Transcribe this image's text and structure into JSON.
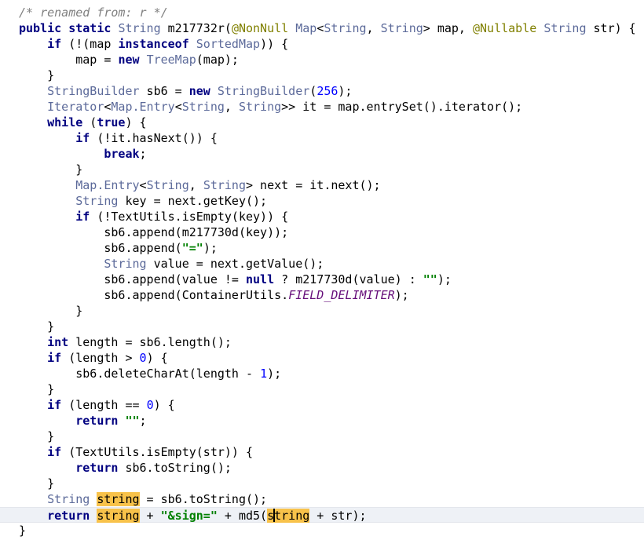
{
  "colors": {
    "keyword": "#000080",
    "type": "#5c6a9a",
    "annotation": "#808000",
    "number": "#0000ff",
    "string": "#008000",
    "comment": "#808080",
    "static_field": "#660e7a",
    "occurrence_highlight": "#f8c24a",
    "current_line": "#eef1f6"
  },
  "editor": {
    "current_line_index": 32,
    "lines": [
      {
        "indent": "",
        "tokens": [
          {
            "t": "/* renamed from: r */",
            "k": "cm"
          }
        ]
      },
      {
        "indent": "",
        "tokens": [
          {
            "t": "public",
            "k": "kw"
          },
          {
            "t": " "
          },
          {
            "t": "static",
            "k": "kw"
          },
          {
            "t": " "
          },
          {
            "t": "String",
            "k": "ty"
          },
          {
            "t": " m217732r("
          },
          {
            "t": "@NonNull",
            "k": "ann"
          },
          {
            "t": " "
          },
          {
            "t": "Map",
            "k": "ty"
          },
          {
            "t": "<"
          },
          {
            "t": "String",
            "k": "ty"
          },
          {
            "t": ", "
          },
          {
            "t": "String",
            "k": "ty"
          },
          {
            "t": "> map, "
          },
          {
            "t": "@Nullable",
            "k": "ann"
          },
          {
            "t": " "
          },
          {
            "t": "String",
            "k": "ty"
          },
          {
            "t": " str) {"
          }
        ]
      },
      {
        "indent": "    ",
        "tokens": [
          {
            "t": "if",
            "k": "kw"
          },
          {
            "t": " (!(map "
          },
          {
            "t": "instanceof",
            "k": "kw"
          },
          {
            "t": " "
          },
          {
            "t": "SortedMap",
            "k": "ty"
          },
          {
            "t": ")) {"
          }
        ]
      },
      {
        "indent": "        ",
        "tokens": [
          {
            "t": "map = "
          },
          {
            "t": "new",
            "k": "kw"
          },
          {
            "t": " "
          },
          {
            "t": "TreeMap",
            "k": "ty"
          },
          {
            "t": "(map);"
          }
        ]
      },
      {
        "indent": "    ",
        "tokens": [
          {
            "t": "}"
          }
        ]
      },
      {
        "indent": "    ",
        "tokens": [
          {
            "t": "StringBuilder",
            "k": "ty"
          },
          {
            "t": " sb6 = "
          },
          {
            "t": "new",
            "k": "kw"
          },
          {
            "t": " "
          },
          {
            "t": "StringBuilder",
            "k": "ty"
          },
          {
            "t": "("
          },
          {
            "t": "256",
            "k": "num"
          },
          {
            "t": ");"
          }
        ]
      },
      {
        "indent": "    ",
        "tokens": [
          {
            "t": "Iterator",
            "k": "ty"
          },
          {
            "t": "<"
          },
          {
            "t": "Map.Entry",
            "k": "ty"
          },
          {
            "t": "<"
          },
          {
            "t": "String",
            "k": "ty"
          },
          {
            "t": ", "
          },
          {
            "t": "String",
            "k": "ty"
          },
          {
            "t": ">> it = map.entrySet().iterator();"
          }
        ]
      },
      {
        "indent": "    ",
        "tokens": [
          {
            "t": "while",
            "k": "kw"
          },
          {
            "t": " ("
          },
          {
            "t": "true",
            "k": "kw"
          },
          {
            "t": ") {"
          }
        ]
      },
      {
        "indent": "        ",
        "tokens": [
          {
            "t": "if",
            "k": "kw"
          },
          {
            "t": " (!it.hasNext()) {"
          }
        ]
      },
      {
        "indent": "            ",
        "tokens": [
          {
            "t": "break",
            "k": "kw"
          },
          {
            "t": ";"
          }
        ]
      },
      {
        "indent": "        ",
        "tokens": [
          {
            "t": "}"
          }
        ]
      },
      {
        "indent": "        ",
        "tokens": [
          {
            "t": "Map.Entry",
            "k": "ty"
          },
          {
            "t": "<"
          },
          {
            "t": "String",
            "k": "ty"
          },
          {
            "t": ", "
          },
          {
            "t": "String",
            "k": "ty"
          },
          {
            "t": "> next = it.next();"
          }
        ]
      },
      {
        "indent": "        ",
        "tokens": [
          {
            "t": "String",
            "k": "ty"
          },
          {
            "t": " key = next.getKey();"
          }
        ]
      },
      {
        "indent": "        ",
        "tokens": [
          {
            "t": "if",
            "k": "kw"
          },
          {
            "t": " (!TextUtils.isEmpty(key)) {"
          }
        ]
      },
      {
        "indent": "            ",
        "tokens": [
          {
            "t": "sb6.append(m217730d(key));"
          }
        ]
      },
      {
        "indent": "            ",
        "tokens": [
          {
            "t": "sb6.append("
          },
          {
            "t": "\"=\"",
            "k": "str"
          },
          {
            "t": ");"
          }
        ]
      },
      {
        "indent": "            ",
        "tokens": [
          {
            "t": "String",
            "k": "ty"
          },
          {
            "t": " value = next.getValue();"
          }
        ]
      },
      {
        "indent": "            ",
        "tokens": [
          {
            "t": "sb6.append(value != "
          },
          {
            "t": "null",
            "k": "kw"
          },
          {
            "t": " ? m217730d(value) : "
          },
          {
            "t": "\"\"",
            "k": "str"
          },
          {
            "t": ");"
          }
        ]
      },
      {
        "indent": "            ",
        "tokens": [
          {
            "t": "sb6.append(ContainerUtils."
          },
          {
            "t": "FIELD_DELIMITER",
            "k": "fi"
          },
          {
            "t": ");"
          }
        ]
      },
      {
        "indent": "        ",
        "tokens": [
          {
            "t": "}"
          }
        ]
      },
      {
        "indent": "    ",
        "tokens": [
          {
            "t": "}"
          }
        ]
      },
      {
        "indent": "    ",
        "tokens": [
          {
            "t": "int",
            "k": "kw"
          },
          {
            "t": " length = sb6.length();"
          }
        ]
      },
      {
        "indent": "    ",
        "tokens": [
          {
            "t": "if",
            "k": "kw"
          },
          {
            "t": " (length > "
          },
          {
            "t": "0",
            "k": "num"
          },
          {
            "t": ") {"
          }
        ]
      },
      {
        "indent": "        ",
        "tokens": [
          {
            "t": "sb6.deleteCharAt(length - "
          },
          {
            "t": "1",
            "k": "num"
          },
          {
            "t": ");"
          }
        ]
      },
      {
        "indent": "    ",
        "tokens": [
          {
            "t": "}"
          }
        ]
      },
      {
        "indent": "    ",
        "tokens": [
          {
            "t": "if",
            "k": "kw"
          },
          {
            "t": " (length == "
          },
          {
            "t": "0",
            "k": "num"
          },
          {
            "t": ") {"
          }
        ]
      },
      {
        "indent": "        ",
        "tokens": [
          {
            "t": "return",
            "k": "kw"
          },
          {
            "t": " "
          },
          {
            "t": "\"\"",
            "k": "str"
          },
          {
            "t": ";"
          }
        ]
      },
      {
        "indent": "    ",
        "tokens": [
          {
            "t": "}"
          }
        ]
      },
      {
        "indent": "    ",
        "tokens": [
          {
            "t": "if",
            "k": "kw"
          },
          {
            "t": " (TextUtils.isEmpty(str)) {"
          }
        ]
      },
      {
        "indent": "        ",
        "tokens": [
          {
            "t": "return",
            "k": "kw"
          },
          {
            "t": " sb6.toString();"
          }
        ]
      },
      {
        "indent": "    ",
        "tokens": [
          {
            "t": "}"
          }
        ]
      },
      {
        "indent": "    ",
        "tokens": [
          {
            "t": "String",
            "k": "ty"
          },
          {
            "t": " "
          },
          {
            "t": "string",
            "hl": true
          },
          {
            "t": " = sb6.toString();"
          }
        ]
      },
      {
        "indent": "    ",
        "tokens": [
          {
            "t": "return",
            "k": "kw"
          },
          {
            "t": " "
          },
          {
            "t": "string",
            "hl": true
          },
          {
            "t": " + "
          },
          {
            "t": "\"&sign=\"",
            "k": "str"
          },
          {
            "t": " + md5("
          },
          {
            "t": "string",
            "hl": true,
            "caret": 1
          },
          {
            "t": " + str);"
          }
        ]
      },
      {
        "indent": "",
        "tokens": [
          {
            "t": "}"
          }
        ]
      }
    ]
  }
}
